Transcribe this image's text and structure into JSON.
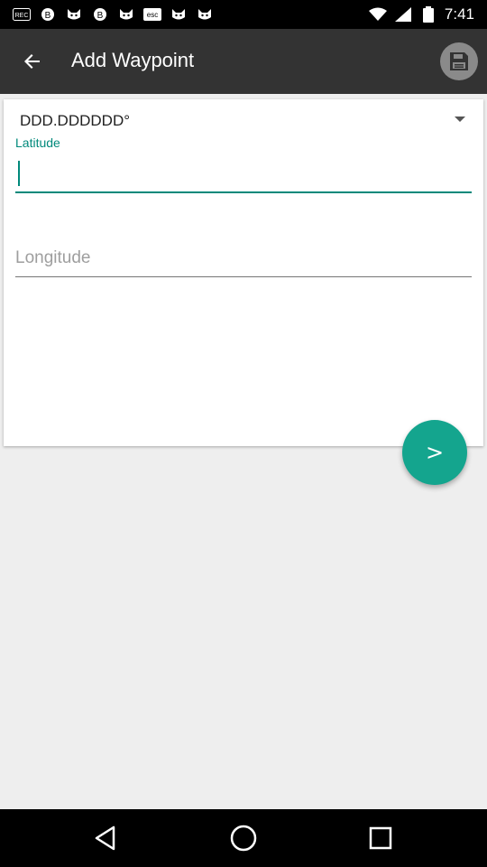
{
  "status_bar": {
    "time": "7:41",
    "icons": [
      "rec-icon",
      "b-coin-icon",
      "cat-icon",
      "b-coin-icon",
      "cat-icon",
      "esc-icon",
      "cat-icon",
      "cat-icon"
    ]
  },
  "app_bar": {
    "title": "Add Waypoint"
  },
  "form": {
    "format_selected": "DDD.DDDDDD°",
    "latitude_label": "Latitude",
    "latitude_value": "",
    "longitude_placeholder": "Longitude",
    "longitude_value": ""
  },
  "fab": {
    "label": ">"
  },
  "colors": {
    "accent": "#00897b",
    "fab": "#14a58e",
    "app_bar": "#333333",
    "background": "#eeeeee"
  }
}
